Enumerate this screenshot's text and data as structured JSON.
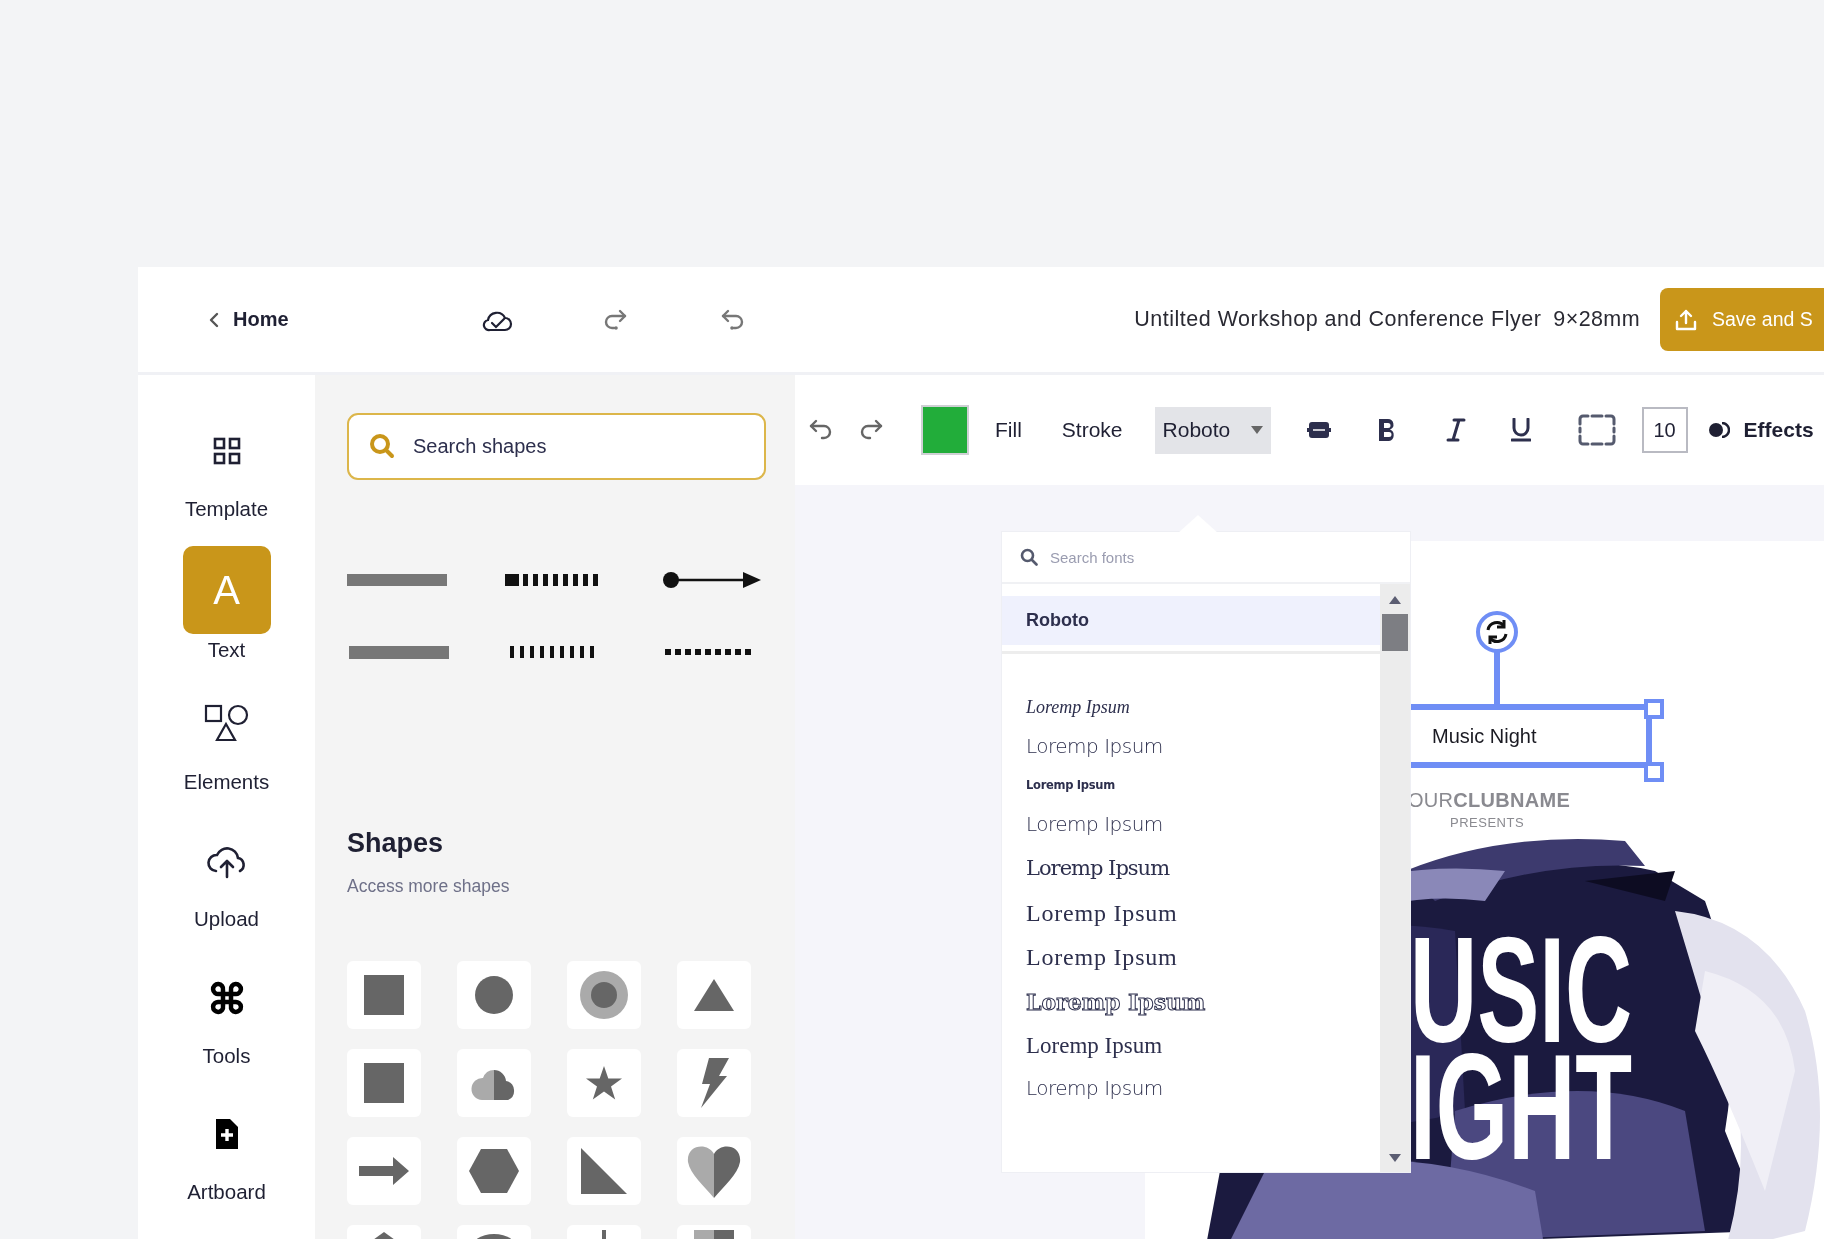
{
  "top_bar": {
    "back_link": "Home",
    "document_title": "Untilted Workshop and Conference Flyer",
    "document_size": "9×28mm",
    "save_button": "Save and S"
  },
  "sidebar": {
    "items": [
      {
        "label": "Template",
        "kind": "template",
        "selected": false
      },
      {
        "label": "Text",
        "kind": "text",
        "glyph": "A",
        "selected": true
      },
      {
        "label": "Elements",
        "kind": "elements",
        "selected": false
      },
      {
        "label": "Upload",
        "kind": "upload",
        "selected": false
      },
      {
        "label": "Tools",
        "kind": "tools",
        "selected": false
      },
      {
        "label": "Artboard",
        "kind": "artboard",
        "selected": false
      }
    ]
  },
  "shapes_panel": {
    "search": {
      "placeholder": "Search shapes"
    },
    "heading": "Shapes",
    "subheading": "Access more shapes"
  },
  "toolbar": {
    "fill_label": "Fill",
    "stroke_label": "Stroke",
    "font": "Roboto",
    "font_size": "10",
    "effects_label": "Effects"
  },
  "font_picker": {
    "search": {
      "placeholder": "Search fonts"
    },
    "options": [
      {
        "label": "Roboto",
        "kind": "sans-bold",
        "selected": true
      },
      {
        "label": "Loremp Ipsum",
        "kind": "script",
        "selected": false
      },
      {
        "label": "Loremp Ipsum",
        "kind": "hand",
        "selected": false
      },
      {
        "label": "Loremp Ipsum",
        "kind": "heavy",
        "selected": false
      },
      {
        "label": "Loremp Ipsum",
        "kind": "hand",
        "selected": false
      },
      {
        "label": "Loremp Ipsum",
        "kind": "thin",
        "selected": false
      },
      {
        "label": "Loremp Ipsum",
        "kind": "serif-bold",
        "selected": false
      },
      {
        "label": "Loremp Ipsum",
        "kind": "serif-bold",
        "selected": false
      },
      {
        "label": "Loremp Ipsum",
        "kind": "outline",
        "selected": false
      },
      {
        "label": "Loremp Ipsum",
        "kind": "serif",
        "selected": false
      },
      {
        "label": "Loremp Ipsum",
        "kind": "hand",
        "selected": false
      }
    ]
  },
  "flyer": {
    "selected_text": "Music Night",
    "club_name": "OUR**CLUBNAME**",
    "presents": "PRESENTS",
    "headline": [
      "USIC",
      "IGHT"
    ]
  }
}
